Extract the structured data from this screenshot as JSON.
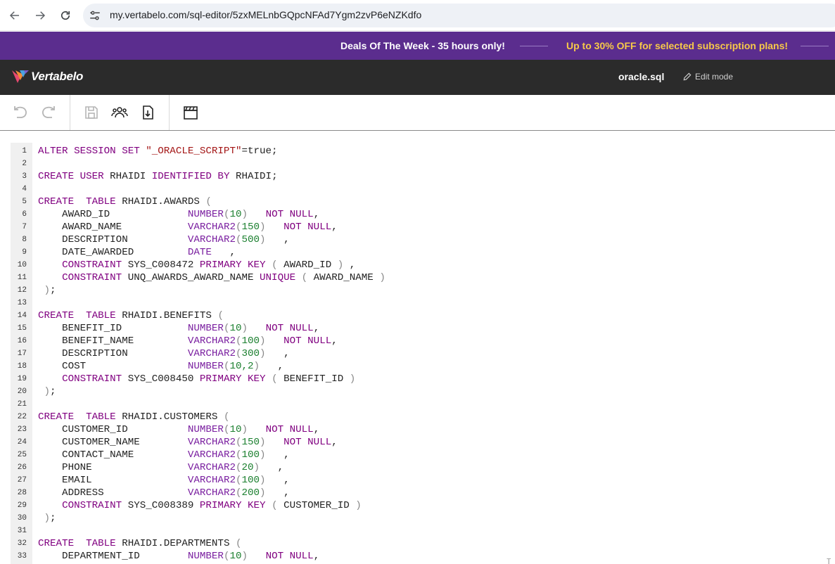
{
  "browser": {
    "url": "my.vertabelo.com/sql-editor/5zxMELnbGQpcNFAd7Ygm2zvP6eNZKdfo",
    "icons": [
      "back-arrow-icon",
      "forward-arrow-icon",
      "reload-icon",
      "site-settings-icon"
    ]
  },
  "promo": {
    "deal_text": "Deals Of The Week - 35 hours only!",
    "offer_text": "Up to 30% OFF for selected subscription plans!",
    "colors": {
      "background": "#5b2d8e",
      "offer": "#f7c948"
    }
  },
  "app": {
    "brand": "Vertabelo",
    "filename": "oracle.sql",
    "edit_mode_label": "Edit mode"
  },
  "toolbar": {
    "icons": [
      "undo-icon",
      "redo-icon",
      "save-icon",
      "collaborators-icon",
      "export-download-icon",
      "clapperboard-icon"
    ]
  },
  "editor": {
    "lines": [
      [
        {
          "t": "ALTER SESSION SET ",
          "c": "kw"
        },
        {
          "t": "\"_ORACLE_SCRIPT\"",
          "c": "str"
        },
        {
          "t": "=true;",
          "c": ""
        }
      ],
      [],
      [
        {
          "t": "CREATE USER ",
          "c": "kw"
        },
        {
          "t": "RHAIDI ",
          "c": ""
        },
        {
          "t": "IDENTIFIED BY ",
          "c": "kw"
        },
        {
          "t": "RHAIDI;",
          "c": ""
        }
      ],
      [],
      [
        {
          "t": "CREATE  TABLE ",
          "c": "kw"
        },
        {
          "t": "RHAIDI.AWARDS ",
          "c": ""
        },
        {
          "t": "(",
          "c": "pn"
        }
      ],
      [
        {
          "t": "    AWARD_ID             ",
          "c": ""
        },
        {
          "t": "NUMBER",
          "c": "ty"
        },
        {
          "t": "(",
          "c": "pn"
        },
        {
          "t": "10",
          "c": "num"
        },
        {
          "t": ")",
          "c": "pn"
        },
        {
          "t": "   ",
          "c": ""
        },
        {
          "t": "NOT NULL",
          "c": "kw"
        },
        {
          "t": ",",
          "c": ""
        }
      ],
      [
        {
          "t": "    AWARD_NAME           ",
          "c": ""
        },
        {
          "t": "VARCHAR2",
          "c": "ty"
        },
        {
          "t": "(",
          "c": "pn"
        },
        {
          "t": "150",
          "c": "num"
        },
        {
          "t": ")",
          "c": "pn"
        },
        {
          "t": "   ",
          "c": ""
        },
        {
          "t": "NOT NULL",
          "c": "kw"
        },
        {
          "t": ",",
          "c": ""
        }
      ],
      [
        {
          "t": "    DESCRIPTION          ",
          "c": ""
        },
        {
          "t": "VARCHAR2",
          "c": "ty"
        },
        {
          "t": "(",
          "c": "pn"
        },
        {
          "t": "500",
          "c": "num"
        },
        {
          "t": ")",
          "c": "pn"
        },
        {
          "t": "   ,",
          "c": ""
        }
      ],
      [
        {
          "t": "    DATE_AWARDED         ",
          "c": ""
        },
        {
          "t": "DATE",
          "c": "ty"
        },
        {
          "t": "   ,",
          "c": ""
        }
      ],
      [
        {
          "t": "    ",
          "c": ""
        },
        {
          "t": "CONSTRAINT ",
          "c": "kw"
        },
        {
          "t": "SYS_C008472 ",
          "c": ""
        },
        {
          "t": "PRIMARY KEY ",
          "c": "kw"
        },
        {
          "t": "( ",
          "c": "pn"
        },
        {
          "t": "AWARD_ID ",
          "c": ""
        },
        {
          "t": ")",
          "c": "pn"
        },
        {
          "t": " ,",
          "c": ""
        }
      ],
      [
        {
          "t": "    ",
          "c": ""
        },
        {
          "t": "CONSTRAINT ",
          "c": "kw"
        },
        {
          "t": "UNQ_AWARDS_AWARD_NAME ",
          "c": ""
        },
        {
          "t": "UNIQUE ",
          "c": "kw"
        },
        {
          "t": "( ",
          "c": "pn"
        },
        {
          "t": "AWARD_NAME ",
          "c": ""
        },
        {
          "t": ")",
          "c": "pn"
        }
      ],
      [
        {
          "t": " ",
          "c": ""
        },
        {
          "t": ")",
          "c": "pn"
        },
        {
          "t": ";",
          "c": ""
        }
      ],
      [],
      [
        {
          "t": "CREATE  TABLE ",
          "c": "kw"
        },
        {
          "t": "RHAIDI.BENEFITS ",
          "c": ""
        },
        {
          "t": "(",
          "c": "pn"
        }
      ],
      [
        {
          "t": "    BENEFIT_ID           ",
          "c": ""
        },
        {
          "t": "NUMBER",
          "c": "ty"
        },
        {
          "t": "(",
          "c": "pn"
        },
        {
          "t": "10",
          "c": "num"
        },
        {
          "t": ")",
          "c": "pn"
        },
        {
          "t": "   ",
          "c": ""
        },
        {
          "t": "NOT NULL",
          "c": "kw"
        },
        {
          "t": ",",
          "c": ""
        }
      ],
      [
        {
          "t": "    BENEFIT_NAME         ",
          "c": ""
        },
        {
          "t": "VARCHAR2",
          "c": "ty"
        },
        {
          "t": "(",
          "c": "pn"
        },
        {
          "t": "100",
          "c": "num"
        },
        {
          "t": ")",
          "c": "pn"
        },
        {
          "t": "   ",
          "c": ""
        },
        {
          "t": "NOT NULL",
          "c": "kw"
        },
        {
          "t": ",",
          "c": ""
        }
      ],
      [
        {
          "t": "    DESCRIPTION          ",
          "c": ""
        },
        {
          "t": "VARCHAR2",
          "c": "ty"
        },
        {
          "t": "(",
          "c": "pn"
        },
        {
          "t": "300",
          "c": "num"
        },
        {
          "t": ")",
          "c": "pn"
        },
        {
          "t": "   ,",
          "c": ""
        }
      ],
      [
        {
          "t": "    COST                 ",
          "c": ""
        },
        {
          "t": "NUMBER",
          "c": "ty"
        },
        {
          "t": "(",
          "c": "pn"
        },
        {
          "t": "10,2",
          "c": "num"
        },
        {
          "t": ")",
          "c": "pn"
        },
        {
          "t": "   ,",
          "c": ""
        }
      ],
      [
        {
          "t": "    ",
          "c": ""
        },
        {
          "t": "CONSTRAINT ",
          "c": "kw"
        },
        {
          "t": "SYS_C008450 ",
          "c": ""
        },
        {
          "t": "PRIMARY KEY ",
          "c": "kw"
        },
        {
          "t": "( ",
          "c": "pn"
        },
        {
          "t": "BENEFIT_ID ",
          "c": ""
        },
        {
          "t": ")",
          "c": "pn"
        }
      ],
      [
        {
          "t": " ",
          "c": ""
        },
        {
          "t": ")",
          "c": "pn"
        },
        {
          "t": ";",
          "c": ""
        }
      ],
      [],
      [
        {
          "t": "CREATE  TABLE ",
          "c": "kw"
        },
        {
          "t": "RHAIDI.CUSTOMERS ",
          "c": ""
        },
        {
          "t": "(",
          "c": "pn"
        }
      ],
      [
        {
          "t": "    CUSTOMER_ID          ",
          "c": ""
        },
        {
          "t": "NUMBER",
          "c": "ty"
        },
        {
          "t": "(",
          "c": "pn"
        },
        {
          "t": "10",
          "c": "num"
        },
        {
          "t": ")",
          "c": "pn"
        },
        {
          "t": "   ",
          "c": ""
        },
        {
          "t": "NOT NULL",
          "c": "kw"
        },
        {
          "t": ",",
          "c": ""
        }
      ],
      [
        {
          "t": "    CUSTOMER_NAME        ",
          "c": ""
        },
        {
          "t": "VARCHAR2",
          "c": "ty"
        },
        {
          "t": "(",
          "c": "pn"
        },
        {
          "t": "150",
          "c": "num"
        },
        {
          "t": ")",
          "c": "pn"
        },
        {
          "t": "   ",
          "c": ""
        },
        {
          "t": "NOT NULL",
          "c": "kw"
        },
        {
          "t": ",",
          "c": ""
        }
      ],
      [
        {
          "t": "    CONTACT_NAME         ",
          "c": ""
        },
        {
          "t": "VARCHAR2",
          "c": "ty"
        },
        {
          "t": "(",
          "c": "pn"
        },
        {
          "t": "100",
          "c": "num"
        },
        {
          "t": ")",
          "c": "pn"
        },
        {
          "t": "   ,",
          "c": ""
        }
      ],
      [
        {
          "t": "    PHONE                ",
          "c": ""
        },
        {
          "t": "VARCHAR2",
          "c": "ty"
        },
        {
          "t": "(",
          "c": "pn"
        },
        {
          "t": "20",
          "c": "num"
        },
        {
          "t": ")",
          "c": "pn"
        },
        {
          "t": "   ,",
          "c": ""
        }
      ],
      [
        {
          "t": "    EMAIL                ",
          "c": ""
        },
        {
          "t": "VARCHAR2",
          "c": "ty"
        },
        {
          "t": "(",
          "c": "pn"
        },
        {
          "t": "100",
          "c": "num"
        },
        {
          "t": ")",
          "c": "pn"
        },
        {
          "t": "   ,",
          "c": ""
        }
      ],
      [
        {
          "t": "    ADDRESS              ",
          "c": ""
        },
        {
          "t": "VARCHAR2",
          "c": "ty"
        },
        {
          "t": "(",
          "c": "pn"
        },
        {
          "t": "200",
          "c": "num"
        },
        {
          "t": ")",
          "c": "pn"
        },
        {
          "t": "   ,",
          "c": ""
        }
      ],
      [
        {
          "t": "    ",
          "c": ""
        },
        {
          "t": "CONSTRAINT ",
          "c": "kw"
        },
        {
          "t": "SYS_C008389 ",
          "c": ""
        },
        {
          "t": "PRIMARY KEY ",
          "c": "kw"
        },
        {
          "t": "( ",
          "c": "pn"
        },
        {
          "t": "CUSTOMER_ID ",
          "c": ""
        },
        {
          "t": ")",
          "c": "pn"
        }
      ],
      [
        {
          "t": " ",
          "c": ""
        },
        {
          "t": ")",
          "c": "pn"
        },
        {
          "t": ";",
          "c": ""
        }
      ],
      [],
      [
        {
          "t": "CREATE  TABLE ",
          "c": "kw"
        },
        {
          "t": "RHAIDI.DEPARTMENTS ",
          "c": ""
        },
        {
          "t": "(",
          "c": "pn"
        }
      ],
      [
        {
          "t": "    DEPARTMENT_ID        ",
          "c": ""
        },
        {
          "t": "NUMBER",
          "c": "ty"
        },
        {
          "t": "(",
          "c": "pn"
        },
        {
          "t": "10",
          "c": "num"
        },
        {
          "t": ")",
          "c": "pn"
        },
        {
          "t": "   ",
          "c": ""
        },
        {
          "t": "NOT NULL",
          "c": "kw"
        },
        {
          "t": ",",
          "c": ""
        }
      ]
    ],
    "line_numbers": [
      "1",
      "2",
      "3",
      "4",
      "5",
      "6",
      "7",
      "8",
      "9",
      "10",
      "11",
      "12",
      "13",
      "14",
      "15",
      "16",
      "17",
      "18",
      "19",
      "20",
      "21",
      "22",
      "23",
      "24",
      "25",
      "26",
      "27",
      "28",
      "29",
      "30",
      "31",
      "32",
      "33"
    ]
  }
}
